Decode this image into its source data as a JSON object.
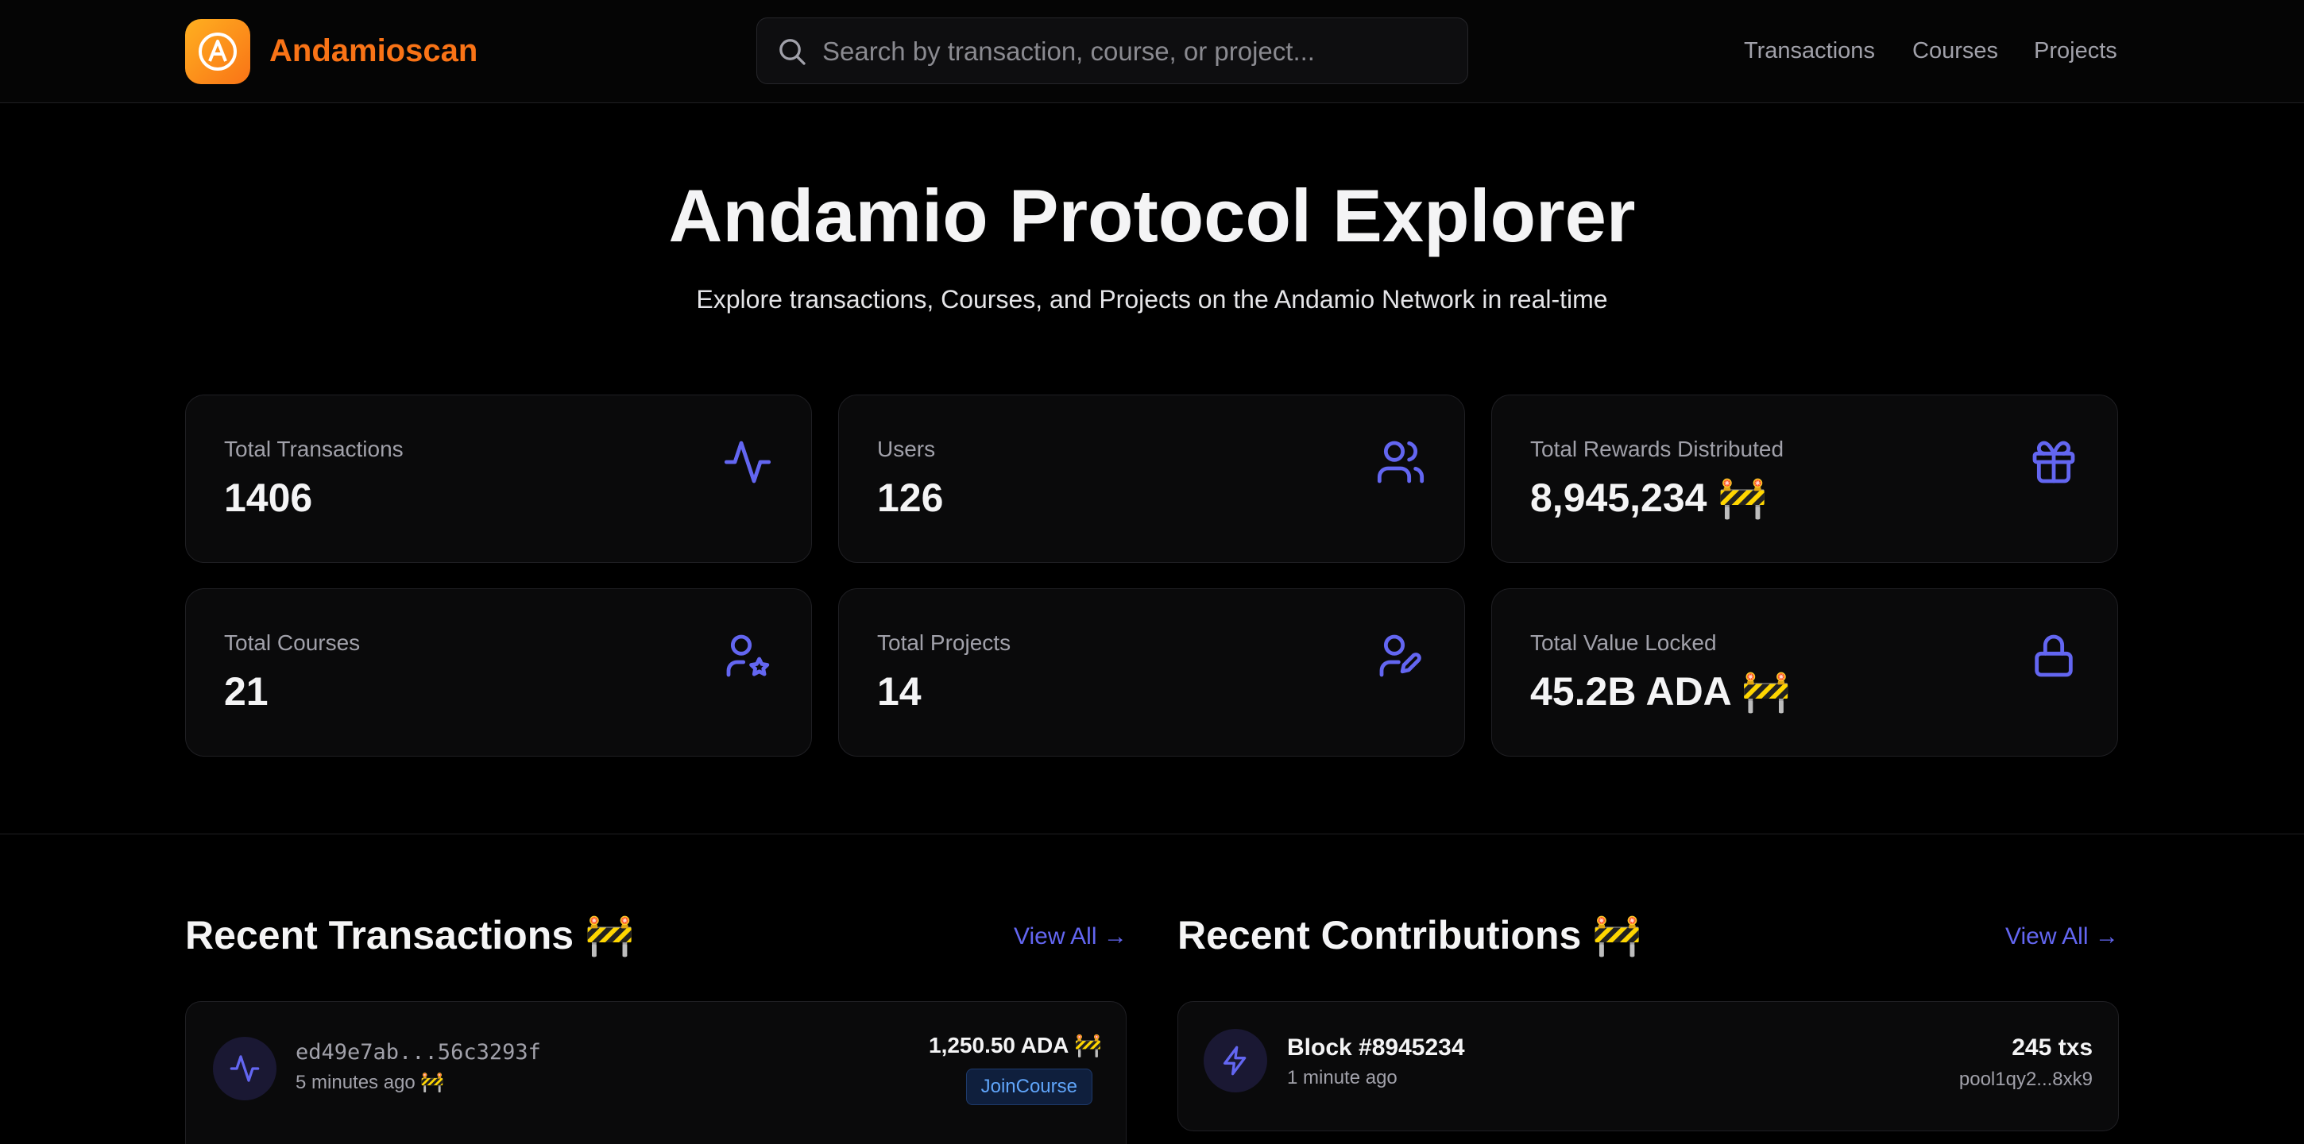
{
  "header": {
    "brand": "Andamioscan",
    "search_placeholder": "Search by transaction, course, or project...",
    "nav": [
      "Transactions",
      "Courses",
      "Projects"
    ]
  },
  "hero": {
    "title": "Andamio Protocol Explorer",
    "subtitle": "Explore transactions, Courses, and Projects on the Andamio Network in real-time"
  },
  "stats": [
    {
      "label": "Total Transactions",
      "value": "1406",
      "icon": "activity-icon"
    },
    {
      "label": "Users",
      "value": "126",
      "icon": "users-icon"
    },
    {
      "label": "Total Rewards Distributed",
      "value": "8,945,234 🚧",
      "icon": "gift-icon"
    },
    {
      "label": "Total Courses",
      "value": "21",
      "icon": "user-star-icon"
    },
    {
      "label": "Total Projects",
      "value": "14",
      "icon": "user-pen-icon"
    },
    {
      "label": "Total Value Locked",
      "value": "45.2B ADA 🚧",
      "icon": "lock-icon"
    }
  ],
  "recent_transactions": {
    "title": "Recent Transactions 🚧",
    "view_all": "View All →",
    "items": [
      {
        "hash": "ed49e7ab...56c3293f",
        "time": "5 minutes ago 🚧",
        "amount": "1,250.50 ADA 🚧",
        "type": "JoinCourse"
      }
    ]
  },
  "recent_contributions": {
    "title": "Recent Contributions 🚧",
    "view_all": "View All →",
    "items": [
      {
        "block": "Block #8945234",
        "time": "1 minute ago",
        "txs": "245 txs",
        "pool": "pool1qy2...8xk9"
      }
    ]
  },
  "colors": {
    "accent": "#6366f1",
    "brand": "#f97316",
    "background": "#000000",
    "card": "#0a0a0b",
    "badge_text": "#60a5fa"
  }
}
